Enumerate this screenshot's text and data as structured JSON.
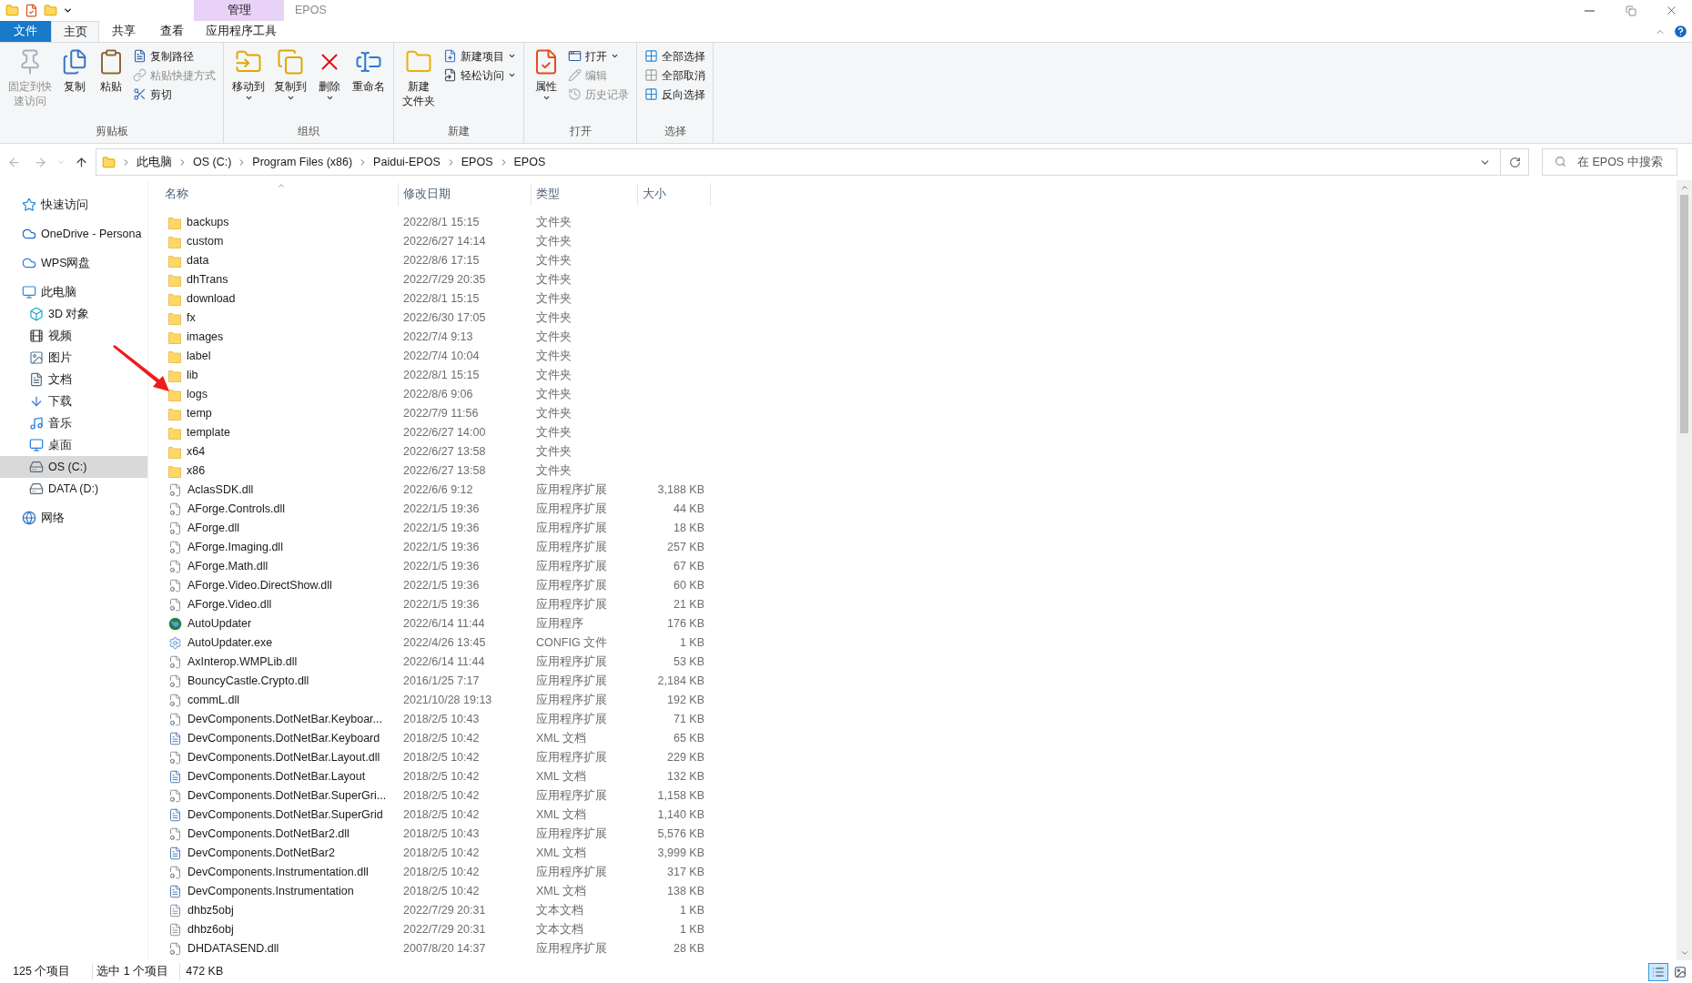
{
  "title_bar": {
    "context_group": "管理",
    "title": "EPOS"
  },
  "ribbon_tabs": [
    {
      "label": "文件",
      "kind": "file",
      "selected": false
    },
    {
      "label": "主页",
      "kind": "tab",
      "selected": true
    },
    {
      "label": "共享",
      "kind": "tab",
      "selected": false
    },
    {
      "label": "查看",
      "kind": "tab",
      "selected": false
    },
    {
      "label": "应用程序工具",
      "kind": "context",
      "selected": false
    }
  ],
  "ribbon_groups": [
    {
      "label": "剪贴板",
      "items": [
        {
          "kind": "large",
          "lines": [
            "固定到快",
            "速访问"
          ],
          "disabled": true,
          "dropdown": false
        },
        {
          "kind": "large",
          "lines": [
            "复制"
          ],
          "disabled": false,
          "dropdown": false
        },
        {
          "kind": "large",
          "lines": [
            "粘贴"
          ],
          "disabled": false,
          "dropdown": false
        },
        {
          "kind": "small",
          "lines": [
            "复制路径"
          ],
          "disabled": false,
          "dropdown": false
        },
        {
          "kind": "small",
          "lines": [
            "粘贴快捷方式"
          ],
          "disabled": true,
          "dropdown": false
        },
        {
          "kind": "small",
          "lines": [
            "剪切"
          ],
          "disabled": false,
          "dropdown": false
        }
      ]
    },
    {
      "label": "组织",
      "items": [
        {
          "kind": "large",
          "lines": [
            "移动到"
          ],
          "disabled": false,
          "dropdown": true
        },
        {
          "kind": "large",
          "lines": [
            "复制到"
          ],
          "disabled": false,
          "dropdown": true
        },
        {
          "kind": "large",
          "lines": [
            "删除"
          ],
          "disabled": false,
          "dropdown": true
        },
        {
          "kind": "large",
          "lines": [
            "重命名"
          ],
          "disabled": false,
          "dropdown": false
        }
      ]
    },
    {
      "label": "新建",
      "items": [
        {
          "kind": "large",
          "lines": [
            "新建",
            "文件夹"
          ],
          "disabled": false,
          "dropdown": false
        },
        {
          "kind": "small",
          "lines": [
            "新建项目"
          ],
          "disabled": false,
          "dropdown": true
        },
        {
          "kind": "small",
          "lines": [
            "轻松访问"
          ],
          "disabled": false,
          "dropdown": true
        }
      ]
    },
    {
      "label": "打开",
      "items": [
        {
          "kind": "large",
          "lines": [
            "属性"
          ],
          "disabled": false,
          "dropdown": true
        },
        {
          "kind": "small",
          "lines": [
            "打开"
          ],
          "disabled": false,
          "dropdown": true
        },
        {
          "kind": "small",
          "lines": [
            "编辑"
          ],
          "disabled": true,
          "dropdown": false
        },
        {
          "kind": "small",
          "lines": [
            "历史记录"
          ],
          "disabled": true,
          "dropdown": false
        }
      ]
    },
    {
      "label": "选择",
      "items": [
        {
          "kind": "small",
          "lines": [
            "全部选择"
          ],
          "disabled": false,
          "dropdown": false
        },
        {
          "kind": "small",
          "lines": [
            "全部取消"
          ],
          "disabled": false,
          "dropdown": false
        },
        {
          "kind": "small",
          "lines": [
            "反向选择"
          ],
          "disabled": false,
          "dropdown": false
        }
      ]
    }
  ],
  "breadcrumbs": [
    "此电脑",
    "OS (C:)",
    "Program Files (x86)",
    "Paidui-EPOS",
    "EPOS",
    "EPOS"
  ],
  "search": {
    "placeholder": "在 EPOS 中搜索"
  },
  "nav_tree": [
    {
      "label": "快速访问",
      "selected": false
    },
    {
      "label": "OneDrive - Persona",
      "selected": false
    },
    {
      "label": "WPS网盘",
      "selected": false
    },
    {
      "label": "此电脑",
      "selected": false,
      "children": [
        {
          "label": "3D 对象",
          "selected": false
        },
        {
          "label": "视频",
          "selected": false
        },
        {
          "label": "图片",
          "selected": false
        },
        {
          "label": "文档",
          "selected": false
        },
        {
          "label": "下载",
          "selected": false
        },
        {
          "label": "音乐",
          "selected": false
        },
        {
          "label": "桌面",
          "selected": false
        },
        {
          "label": "OS (C:)",
          "selected": true
        },
        {
          "label": "DATA (D:)",
          "selected": false
        }
      ]
    },
    {
      "label": "网络",
      "selected": false
    }
  ],
  "columns": [
    {
      "label": "名称",
      "sorted": true
    },
    {
      "label": "修改日期",
      "sorted": false
    },
    {
      "label": "类型",
      "sorted": false
    },
    {
      "label": "大小",
      "sorted": false
    }
  ],
  "rows": [
    {
      "name": "backups",
      "modified": "2022/8/1 15:15",
      "type": "文件夹",
      "kind": "folder"
    },
    {
      "name": "custom",
      "modified": "2022/6/27 14:14",
      "type": "文件夹",
      "kind": "folder"
    },
    {
      "name": "data",
      "modified": "2022/8/6 17:15",
      "type": "文件夹",
      "kind": "folder"
    },
    {
      "name": "dhTrans",
      "modified": "2022/7/29 20:35",
      "type": "文件夹",
      "kind": "folder"
    },
    {
      "name": "download",
      "modified": "2022/8/1 15:15",
      "type": "文件夹",
      "kind": "folder"
    },
    {
      "name": "fx",
      "modified": "2022/6/30 17:05",
      "type": "文件夹",
      "kind": "folder"
    },
    {
      "name": "images",
      "modified": "2022/7/4 9:13",
      "type": "文件夹",
      "kind": "folder"
    },
    {
      "name": "label",
      "modified": "2022/7/4 10:04",
      "type": "文件夹",
      "kind": "folder"
    },
    {
      "name": "lib",
      "modified": "2022/8/1 15:15",
      "type": "文件夹",
      "kind": "folder"
    },
    {
      "name": "logs",
      "modified": "2022/8/6 9:06",
      "type": "文件夹",
      "kind": "folder"
    },
    {
      "name": "temp",
      "modified": "2022/7/9 11:56",
      "type": "文件夹",
      "kind": "folder"
    },
    {
      "name": "template",
      "modified": "2022/6/27 14:00",
      "type": "文件夹",
      "kind": "folder"
    },
    {
      "name": "x64",
      "modified": "2022/6/27 13:58",
      "type": "文件夹",
      "kind": "folder"
    },
    {
      "name": "x86",
      "modified": "2022/6/27 13:58",
      "type": "文件夹",
      "kind": "folder"
    },
    {
      "name": "AclasSDK.dll",
      "modified": "2022/6/6 9:12",
      "type": "应用程序扩展",
      "size": "3,188 KB",
      "kind": "dll"
    },
    {
      "name": "AForge.Controls.dll",
      "modified": "2022/1/5 19:36",
      "type": "应用程序扩展",
      "size": "44 KB",
      "kind": "dll"
    },
    {
      "name": "AForge.dll",
      "modified": "2022/1/5 19:36",
      "type": "应用程序扩展",
      "size": "18 KB",
      "kind": "dll"
    },
    {
      "name": "AForge.Imaging.dll",
      "modified": "2022/1/5 19:36",
      "type": "应用程序扩展",
      "size": "257 KB",
      "kind": "dll"
    },
    {
      "name": "AForge.Math.dll",
      "modified": "2022/1/5 19:36",
      "type": "应用程序扩展",
      "size": "67 KB",
      "kind": "dll"
    },
    {
      "name": "AForge.Video.DirectShow.dll",
      "modified": "2022/1/5 19:36",
      "type": "应用程序扩展",
      "size": "60 KB",
      "kind": "dll"
    },
    {
      "name": "AForge.Video.dll",
      "modified": "2022/1/5 19:36",
      "type": "应用程序扩展",
      "size": "21 KB",
      "kind": "dll"
    },
    {
      "name": "AutoUpdater",
      "modified": "2022/6/14 11:44",
      "type": "应用程序",
      "size": "176 KB",
      "kind": "app"
    },
    {
      "name": "AutoUpdater.exe",
      "modified": "2022/4/26 13:45",
      "type": "CONFIG 文件",
      "size": "1 KB",
      "kind": "config"
    },
    {
      "name": "AxInterop.WMPLib.dll",
      "modified": "2022/6/14 11:44",
      "type": "应用程序扩展",
      "size": "53 KB",
      "kind": "dll"
    },
    {
      "name": "BouncyCastle.Crypto.dll",
      "modified": "2016/1/25 7:17",
      "type": "应用程序扩展",
      "size": "2,184 KB",
      "kind": "dll"
    },
    {
      "name": "commL.dll",
      "modified": "2021/10/28 19:13",
      "type": "应用程序扩展",
      "size": "192 KB",
      "kind": "dll"
    },
    {
      "name": "DevComponents.DotNetBar.Keyboar...",
      "modified": "2018/2/5 10:43",
      "type": "应用程序扩展",
      "size": "71 KB",
      "kind": "dll"
    },
    {
      "name": "DevComponents.DotNetBar.Keyboard",
      "modified": "2018/2/5 10:42",
      "type": "XML 文档",
      "size": "65 KB",
      "kind": "xml"
    },
    {
      "name": "DevComponents.DotNetBar.Layout.dll",
      "modified": "2018/2/5 10:42",
      "type": "应用程序扩展",
      "size": "229 KB",
      "kind": "dll"
    },
    {
      "name": "DevComponents.DotNetBar.Layout",
      "modified": "2018/2/5 10:42",
      "type": "XML 文档",
      "size": "132 KB",
      "kind": "xml"
    },
    {
      "name": "DevComponents.DotNetBar.SuperGri...",
      "modified": "2018/2/5 10:42",
      "type": "应用程序扩展",
      "size": "1,158 KB",
      "kind": "dll"
    },
    {
      "name": "DevComponents.DotNetBar.SuperGrid",
      "modified": "2018/2/5 10:42",
      "type": "XML 文档",
      "size": "1,140 KB",
      "kind": "xml"
    },
    {
      "name": "DevComponents.DotNetBar2.dll",
      "modified": "2018/2/5 10:43",
      "type": "应用程序扩展",
      "size": "5,576 KB",
      "kind": "dll"
    },
    {
      "name": "DevComponents.DotNetBar2",
      "modified": "2018/2/5 10:42",
      "type": "XML 文档",
      "size": "3,999 KB",
      "kind": "xml"
    },
    {
      "name": "DevComponents.Instrumentation.dll",
      "modified": "2018/2/5 10:42",
      "type": "应用程序扩展",
      "size": "317 KB",
      "kind": "dll"
    },
    {
      "name": "DevComponents.Instrumentation",
      "modified": "2018/2/5 10:42",
      "type": "XML 文档",
      "size": "138 KB",
      "kind": "xml"
    },
    {
      "name": "dhbz5obj",
      "modified": "2022/7/29 20:31",
      "type": "文本文档",
      "size": "1 KB",
      "kind": "text"
    },
    {
      "name": "dhbz6obj",
      "modified": "2022/7/29 20:31",
      "type": "文本文档",
      "size": "1 KB",
      "kind": "text"
    },
    {
      "name": "DHDATASEND.dll",
      "modified": "2007/8/20 14:37",
      "type": "应用程序扩展",
      "size": "28 KB",
      "kind": "dll"
    }
  ],
  "status_bar": {
    "item_count": "125 个项目",
    "selection": "选中 1 个项目",
    "selection_size": "472 KB"
  },
  "view_modes": [
    {
      "kind": "details",
      "selected": true
    },
    {
      "kind": "large_icons",
      "selected": false
    }
  ]
}
